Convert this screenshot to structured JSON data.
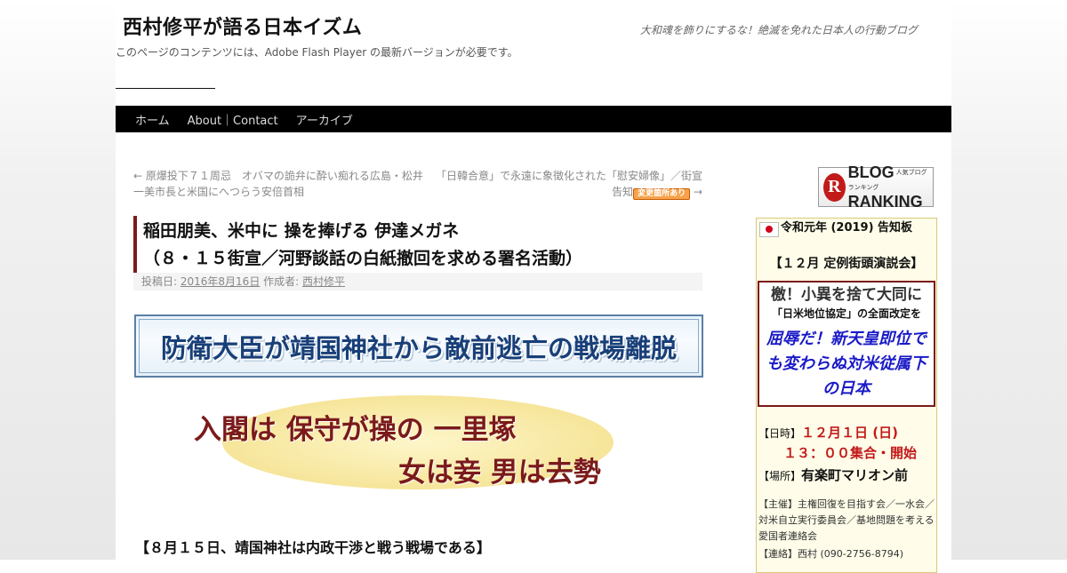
{
  "site": {
    "title": "西村修平が語る日本イズム",
    "description": "大和魂を飾りにするな！絶滅を免れた日本人の行動ブログ",
    "flash_notice": "このページのコンテンツには、Adobe Flash Player の最新バージョンが必要です。"
  },
  "nav": {
    "items": [
      "ホーム",
      "About｜Contact",
      "アーカイブ"
    ]
  },
  "post_nav": {
    "prev": "← 原爆投下７１周忌　オバマの詭弁に酔い痴れる広島・松井一美市長と米国にへつらう安倍首相",
    "next_text": "「日韓合意」で永遠に象徴化された「慰安婦像」／街宣告知",
    "next_badge": "変更箇所あり",
    "next_arrow": "→"
  },
  "entry": {
    "title_line1": "稲田朋美、米中に 操を捧げる 伊達メガネ",
    "title_line2": "（８・１５街宣／河野談話の白紙撤回を求める署名活動）",
    "meta_posted": "投稿日:",
    "meta_date": "2016年8月16日",
    "meta_author_label": "作成者:",
    "meta_author": "西村修平",
    "banner1": "防衛大臣が靖国神社から敵前逃亡の戦場離脱",
    "banner2_line1": "入閣は 保守が操の 一里塚",
    "banner2_line2": "女は妾 男は去勢",
    "section_head": "【８月１５日、靖国神社は内政干渉と戦う戦場である】"
  },
  "sidebar": {
    "ranking": {
      "logo_letter": "R",
      "text": "BLOG",
      "text2": "RANKING",
      "small": "人気ブログランキング"
    },
    "widget": {
      "title": "令和元年 (2019) 告知板",
      "subtitle": "【１２月 定例街頭演説会】",
      "box_line1": "檄！小異を捨て大同に",
      "box_line2": "「日米地位協定」の全面改定を",
      "box_line3": "屈辱だ！新天皇即位でも変わらぬ対米従属下の日本",
      "date_label": "【日時】",
      "date_value": "１２月１日 (日)",
      "time_value": "１３：００集合・開始",
      "place_label": "【場所】",
      "place_value": "有楽町マリオン前",
      "organizer": "【主催】主権回復を目指す会／一水会／対米自立実行委員会／基地問題を考える愛国者連絡会",
      "contact": "【連絡】西村 (090-2756-8794)"
    }
  }
}
